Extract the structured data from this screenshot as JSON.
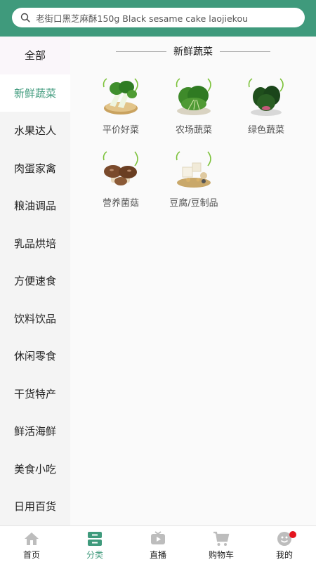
{
  "search": {
    "text": "老街口黑芝麻酥150g Black sesame cake laojiekou",
    "icon": "search-icon"
  },
  "sidebar": {
    "items": [
      {
        "label": "全部"
      },
      {
        "label": "新鲜蔬菜",
        "active": true
      },
      {
        "label": "水果达人"
      },
      {
        "label": "肉蛋家禽"
      },
      {
        "label": "粮油调品"
      },
      {
        "label": "乳品烘培"
      },
      {
        "label": "方便速食"
      },
      {
        "label": "饮料饮品"
      },
      {
        "label": "休闲零食"
      },
      {
        "label": "干货特产"
      },
      {
        "label": "鲜活海鲜"
      },
      {
        "label": "美食小吃"
      },
      {
        "label": "日用百货"
      }
    ]
  },
  "section": {
    "title": "新鲜蔬菜",
    "categories": [
      {
        "label": "平价好菜",
        "icon": "bok-choy-image"
      },
      {
        "label": "农场蔬菜",
        "icon": "leafy-greens-image"
      },
      {
        "label": "绿色蔬菜",
        "icon": "spinach-image"
      },
      {
        "label": "营养菌菇",
        "icon": "mushroom-image"
      },
      {
        "label": "豆腐/豆制品",
        "icon": "tofu-image"
      }
    ]
  },
  "tabbar": {
    "items": [
      {
        "label": "首页",
        "icon": "home-icon"
      },
      {
        "label": "分类",
        "icon": "category-icon",
        "active": true
      },
      {
        "label": "直播",
        "icon": "live-icon"
      },
      {
        "label": "购物车",
        "icon": "cart-icon"
      },
      {
        "label": "我的",
        "icon": "profile-icon",
        "badge": true
      }
    ]
  },
  "colors": {
    "accent": "#3f9a7c",
    "badge": "#e4141e"
  }
}
